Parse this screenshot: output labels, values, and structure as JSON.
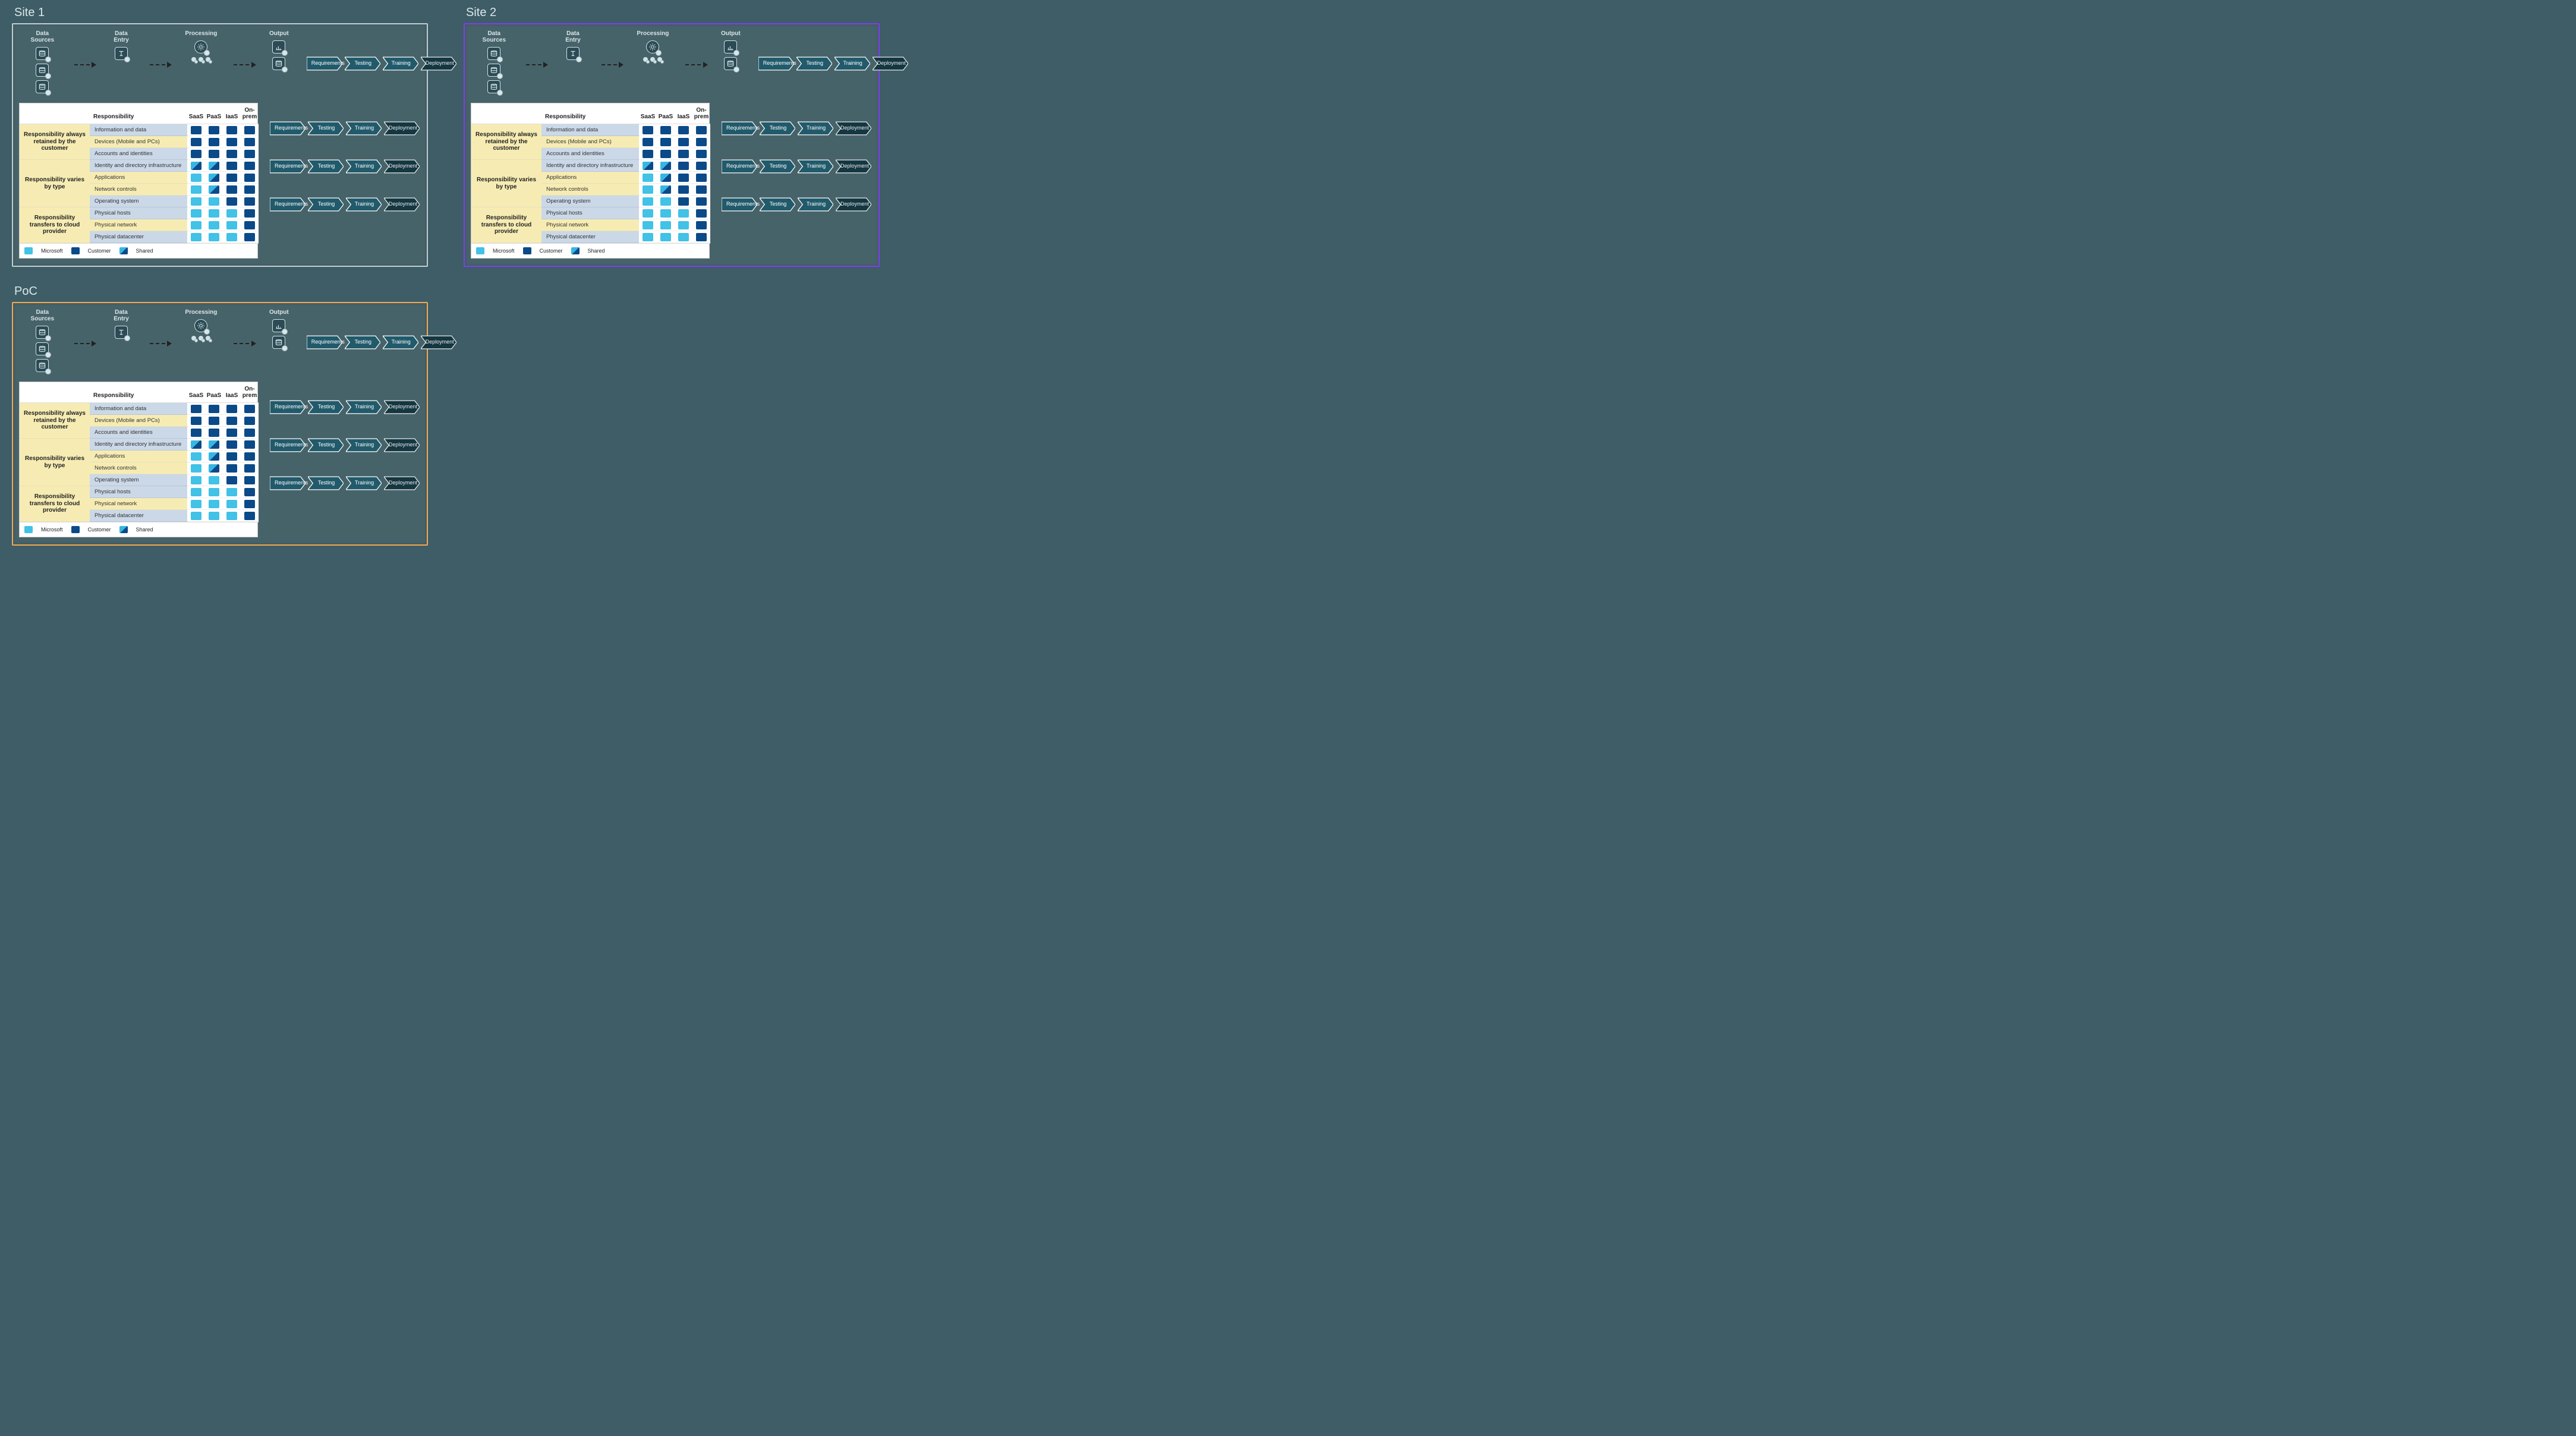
{
  "panels": [
    {
      "title": "Site 1",
      "border": "b1"
    },
    {
      "title": "Site 2",
      "border": "b2"
    },
    {
      "title": "PoC",
      "border": "b3"
    }
  ],
  "pipeline": {
    "headers": [
      "Data Sources",
      "Data Entry",
      "Processing",
      "Output"
    ]
  },
  "chevrons": {
    "steps": [
      "Requirements",
      "Testing",
      "Training",
      "Deployment"
    ]
  },
  "matrix": {
    "headers": {
      "responsibility": "Responsibility",
      "cols": [
        "SaaS",
        "PaaS",
        "IaaS",
        "On-prem"
      ]
    },
    "groups": [
      {
        "label": "Responsibility always retained by the customer",
        "rows": [
          {
            "label": "Information and data",
            "cells": [
              "cust",
              "cust",
              "cust",
              "cust"
            ]
          },
          {
            "label": "Devices (Mobile and PCs)",
            "cells": [
              "cust",
              "cust",
              "cust",
              "cust"
            ],
            "yellow": true
          },
          {
            "label": "Accounts and identities",
            "cells": [
              "cust",
              "cust",
              "cust",
              "cust"
            ]
          }
        ]
      },
      {
        "label": "Responsibility varies by type",
        "rows": [
          {
            "label": "Identity and directory infrastructure",
            "cells": [
              "shared",
              "shared",
              "cust",
              "cust"
            ]
          },
          {
            "label": "Applications",
            "cells": [
              "ms",
              "shared",
              "cust",
              "cust"
            ],
            "yellow": true
          },
          {
            "label": "Network controls",
            "cells": [
              "ms",
              "shared",
              "cust",
              "cust"
            ],
            "yellow": true
          },
          {
            "label": "Operating system",
            "cells": [
              "ms",
              "ms",
              "cust",
              "cust"
            ]
          }
        ]
      },
      {
        "label": "Responsibility transfers to cloud provider",
        "rows": [
          {
            "label": "Physical hosts",
            "cells": [
              "ms",
              "ms",
              "ms",
              "cust"
            ]
          },
          {
            "label": "Physical network",
            "cells": [
              "ms",
              "ms",
              "ms",
              "cust"
            ],
            "yellow": true
          },
          {
            "label": "Physical datacenter",
            "cells": [
              "ms",
              "ms",
              "ms",
              "cust"
            ]
          }
        ]
      }
    ],
    "legend": [
      {
        "label": "Microsoft",
        "k": "ms"
      },
      {
        "label": "Customer",
        "k": "cust"
      },
      {
        "label": "Shared",
        "k": "shared"
      }
    ]
  }
}
